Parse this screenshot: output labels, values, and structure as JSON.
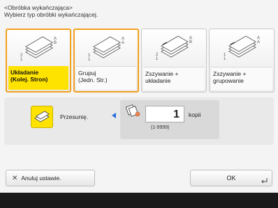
{
  "header": {
    "title": "<Obróbka wykańczająca>",
    "subtitle": "Wybierz typ obróbki wykańczającej."
  },
  "options": [
    {
      "line1": "Układanie",
      "line2": "(Kolej. Stron)",
      "icon": "collate-pages-icon",
      "selected": true
    },
    {
      "line1": "Grupuj",
      "line2": "(Jedn. Str.)",
      "icon": "group-pages-icon",
      "selected": false
    },
    {
      "line1": "Zszywanie +",
      "line2": "układanie",
      "icon": "staple-collate-icon",
      "selected": false
    },
    {
      "line1": "Zszywanie +",
      "line2": "grupowanie",
      "icon": "staple-group-icon",
      "selected": false
    }
  ],
  "shift": {
    "label": "Przesunię."
  },
  "copies": {
    "value": "1",
    "unit": "kopii",
    "range": "(1-9999)"
  },
  "buttons": {
    "cancel": "Anuluj ustawie.",
    "ok": "OK"
  },
  "colors": {
    "accent": "#ffe300",
    "highlight_ring": "#f2a020",
    "arrow": "#2a6fd8"
  }
}
